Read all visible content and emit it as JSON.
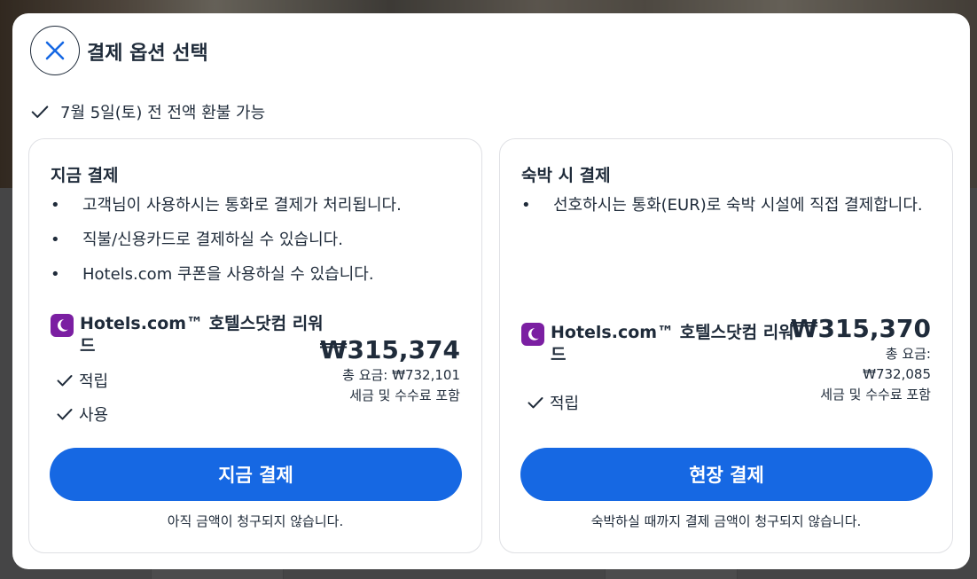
{
  "dialog": {
    "title": "결제 옵션 선택",
    "refund_text": "7월 5일(토) 전 전액 환불 가능"
  },
  "options": [
    {
      "heading": "지금 결제",
      "bullets": [
        "고객님이 사용하시는 통화로 결제가 처리됩니다.",
        "직불/신용카드로 결제하실 수 있습니다.",
        "Hotels.com 쿠폰을 사용하실 수 있습니다."
      ],
      "rewards_name": "Hotels.com™ 호텔스닷컴 리워드",
      "reward_items": [
        "적립",
        "사용"
      ],
      "price": "₩315,374",
      "total_label": "총 요금: ₩732,101",
      "tax_note": "세금 및 수수료 포함",
      "button_label": "지금 결제",
      "note": "아직 금액이 청구되지 않습니다."
    },
    {
      "heading": "숙박 시 결제",
      "bullets": [
        "선호하시는 통화(EUR)로 숙박 시설에 직접 결제합니다."
      ],
      "rewards_name": "Hotels.com™ 호텔스닷컴 리워드",
      "reward_items": [
        "적립"
      ],
      "price": "₩315,370",
      "total_label_1": "총 요금:",
      "total_label_2": "₩732,085",
      "tax_note": "세금 및 수수료 포함",
      "button_label": "현장 결제",
      "note": "숙박하실 때까지 결제 금액이 청구되지 않습니다."
    }
  ],
  "colors": {
    "primary_button": "#1668e3",
    "rewards_brand": "#7b1fa2",
    "text": "#1f2b3a"
  }
}
